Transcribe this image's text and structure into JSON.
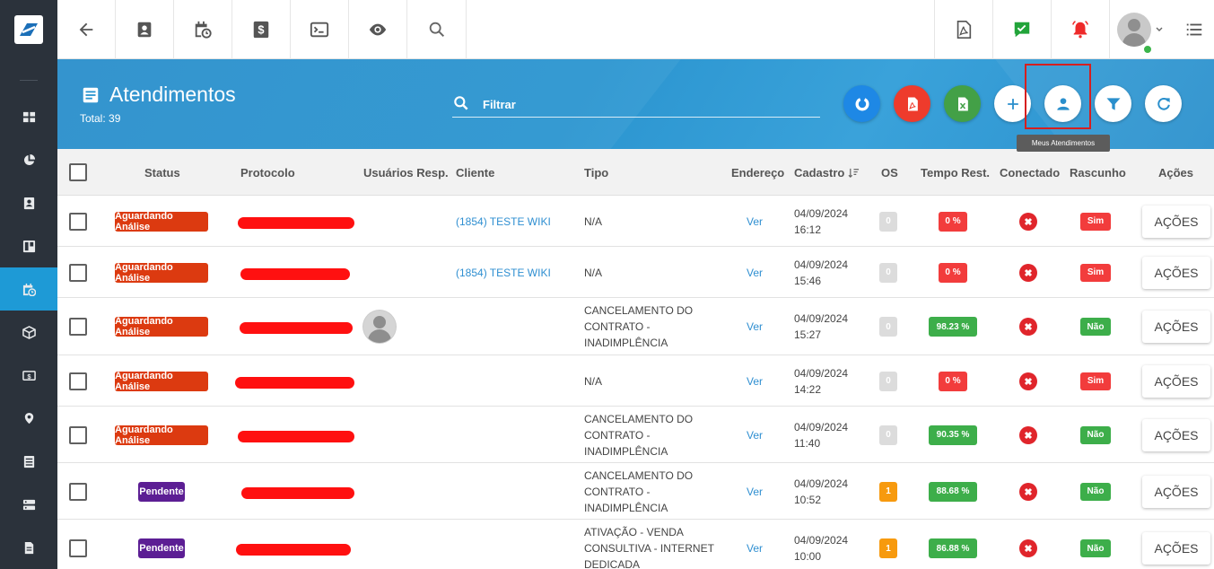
{
  "page": {
    "title": "Atendimentos",
    "total": "Total: 39"
  },
  "filter": {
    "placeholder": "Filtrar"
  },
  "tooltip": "Meus Atendimentos",
  "colors": {
    "sidebar": "#2b323b",
    "sidebar_active": "#1e9ad6",
    "banner": "#2b95d0",
    "status_aguardando": "#dc3a10",
    "status_pendente": "#5c1e94",
    "tempo_red": "#f23c3c",
    "tempo_green": "#3dae4a",
    "os_grey": "#dcdcdc",
    "os_orange": "#f79a0e"
  },
  "sidebar": {
    "items": [
      "grid-icon",
      "pie-chart-icon",
      "contact-card-icon",
      "board-icon",
      "calendar-clock-icon",
      "box-icon",
      "money-icon",
      "map-pin-icon",
      "list-icon",
      "server-icon",
      "document-icon"
    ]
  },
  "toolbar": {
    "left": [
      "back-arrow-icon",
      "contact-card-icon",
      "calendar-clock-icon",
      "dollar-icon",
      "terminal-icon",
      "eye-icon",
      "search-icon"
    ],
    "right": [
      "pdf-icon",
      "chat-check-icon",
      "alarm-bell-icon",
      "user-avatar",
      "menu-list-icon"
    ]
  },
  "actions": [
    "donut-chart-icon",
    "pdf-icon",
    "excel-icon",
    "plus-icon",
    "user-icon",
    "filter-icon",
    "refresh-icon"
  ],
  "columns": {
    "status": "Status",
    "protocolo": "Protocolo",
    "usuarios": "Usuários Resp.",
    "cliente": "Cliente",
    "tipo": "Tipo",
    "endereco": "Endereço",
    "cadastro": "Cadastro",
    "os": "OS",
    "tempo": "Tempo Rest.",
    "conectado": "Conectado",
    "rascunho": "Rascunho",
    "acoes": "Ações"
  },
  "rows": [
    {
      "status": "Aguardando Análise",
      "status_type": "ag",
      "cliente": "(1854) TESTE WIKI",
      "tipo": [
        "N/A"
      ],
      "endereco": "Ver",
      "cadastro_date": "04/09/2024",
      "cadastro_time": "16:12",
      "os": "0",
      "tempo": "0 %",
      "tempo_type": "red",
      "rascunho": "Sim",
      "acoes": "AÇÕES",
      "avatar": false
    },
    {
      "status": "Aguardando Análise",
      "status_type": "ag",
      "cliente": "(1854) TESTE WIKI",
      "tipo": [
        "N/A"
      ],
      "endereco": "Ver",
      "cadastro_date": "04/09/2024",
      "cadastro_time": "15:46",
      "os": "0",
      "tempo": "0 %",
      "tempo_type": "red",
      "rascunho": "Sim",
      "acoes": "AÇÕES",
      "avatar": false
    },
    {
      "status": "Aguardando Análise",
      "status_type": "ag",
      "cliente": "",
      "tipo": [
        "CANCELAMENTO DO",
        "CONTRATO -",
        "INADIMPLÊNCIA"
      ],
      "endereco": "Ver",
      "cadastro_date": "04/09/2024",
      "cadastro_time": "15:27",
      "os": "0",
      "tempo": "98.23 %",
      "tempo_type": "green",
      "rascunho": "Não",
      "acoes": "AÇÕES",
      "avatar": true
    },
    {
      "status": "Aguardando Análise",
      "status_type": "ag",
      "cliente": "",
      "tipo": [
        "N/A"
      ],
      "endereco": "Ver",
      "cadastro_date": "04/09/2024",
      "cadastro_time": "14:22",
      "os": "0",
      "tempo": "0 %",
      "tempo_type": "red",
      "rascunho": "Sim",
      "acoes": "AÇÕES",
      "avatar": false
    },
    {
      "status": "Aguardando Análise",
      "status_type": "ag",
      "cliente": "",
      "tipo": [
        "CANCELAMENTO DO",
        "CONTRATO -",
        "INADIMPLÊNCIA"
      ],
      "endereco": "Ver",
      "cadastro_date": "04/09/2024",
      "cadastro_time": "11:40",
      "os": "0",
      "tempo": "90.35 %",
      "tempo_type": "green",
      "rascunho": "Não",
      "acoes": "AÇÕES",
      "avatar": false
    },
    {
      "status": "Pendente",
      "status_type": "pe",
      "cliente": "",
      "tipo": [
        "CANCELAMENTO DO",
        "CONTRATO -",
        "INADIMPLÊNCIA"
      ],
      "endereco": "Ver",
      "cadastro_date": "04/09/2024",
      "cadastro_time": "10:52",
      "os": "1",
      "tempo": "88.68 %",
      "tempo_type": "green",
      "rascunho": "Não",
      "acoes": "AÇÕES",
      "avatar": false
    },
    {
      "status": "Pendente",
      "status_type": "pe",
      "cliente": "",
      "tipo": [
        "ATIVAÇÃO - VENDA",
        "CONSULTIVA - INTERNET",
        "DEDICADA"
      ],
      "endereco": "Ver",
      "cadastro_date": "04/09/2024",
      "cadastro_time": "10:00",
      "os": "1",
      "tempo": "86.88 %",
      "tempo_type": "green",
      "rascunho": "Não",
      "acoes": "AÇÕES",
      "avatar": false
    }
  ]
}
